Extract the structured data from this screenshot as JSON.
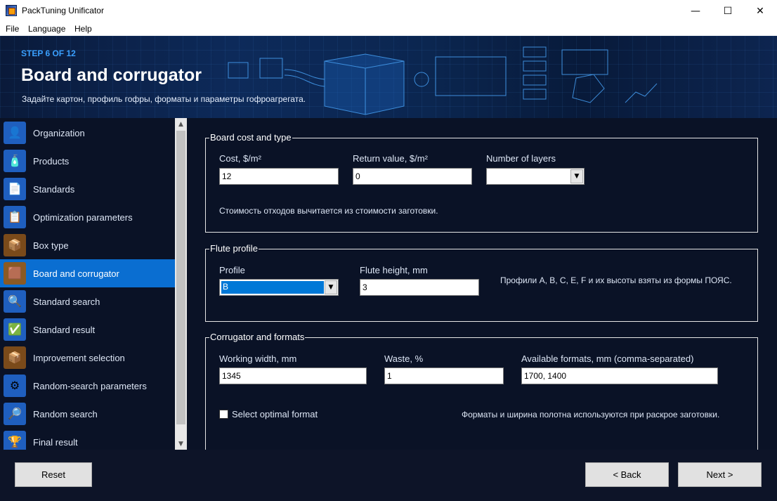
{
  "window": {
    "title": "PackTuning Unificator",
    "minimize": "—",
    "maximize": "☐",
    "close": "✕"
  },
  "menu": [
    "File",
    "Language",
    "Help"
  ],
  "banner": {
    "step": "STEP 6 OF 12",
    "title": "Board and corrugator",
    "subtitle": "Задайте картон, профиль гофры, форматы и параметры гофроагрегата."
  },
  "sidebar": {
    "items": [
      {
        "label": "Organization",
        "icon": "organization-icon"
      },
      {
        "label": "Products",
        "icon": "products-icon"
      },
      {
        "label": "Standards",
        "icon": "standards-icon"
      },
      {
        "label": "Optimization parameters",
        "icon": "optimization-icon"
      },
      {
        "label": "Box type",
        "icon": "box-icon"
      },
      {
        "label": "Board and corrugator",
        "icon": "board-icon",
        "active": true
      },
      {
        "label": "Standard search",
        "icon": "search-icon"
      },
      {
        "label": "Standard result",
        "icon": "result-icon"
      },
      {
        "label": "Improvement selection",
        "icon": "improvement-icon"
      },
      {
        "label": "Random-search parameters",
        "icon": "random-params-icon"
      },
      {
        "label": "Random search",
        "icon": "random-search-icon"
      },
      {
        "label": "Final result",
        "icon": "trophy-icon"
      }
    ]
  },
  "board_cost": {
    "legend": "Board cost and type",
    "cost_label": "Cost, $/m²",
    "cost_value": "12",
    "return_label": "Return value, $/m²",
    "return_value": "0",
    "layers_label": "Number of layers",
    "layers_value": "",
    "note": "Стоимость отходов вычитается из стоимости заготовки."
  },
  "flute": {
    "legend": "Flute profile",
    "profile_label": "Profile",
    "profile_value": "B",
    "height_label": "Flute height, mm",
    "height_value": "3",
    "note": "Профили A, B, C, E, F и их высоты взяты из формы ПОЯС."
  },
  "corrugator": {
    "legend": "Corrugator and formats",
    "width_label": "Working width, mm",
    "width_value": "1345",
    "waste_label": "Waste, %",
    "waste_value": "1",
    "formats_label": "Available formats, mm (comma-separated)",
    "formats_value": "1700, 1400",
    "checkbox_label": "Select optimal format",
    "checkbox_checked": false,
    "note": "Форматы и ширина полотна используются при раскрое заготовки."
  },
  "buttons": {
    "reset": "Reset",
    "back": "< Back",
    "next": "Next >"
  },
  "colors": {
    "accent": "#0a6ed1",
    "background": "#0a1226",
    "step": "#3aa0ff"
  }
}
